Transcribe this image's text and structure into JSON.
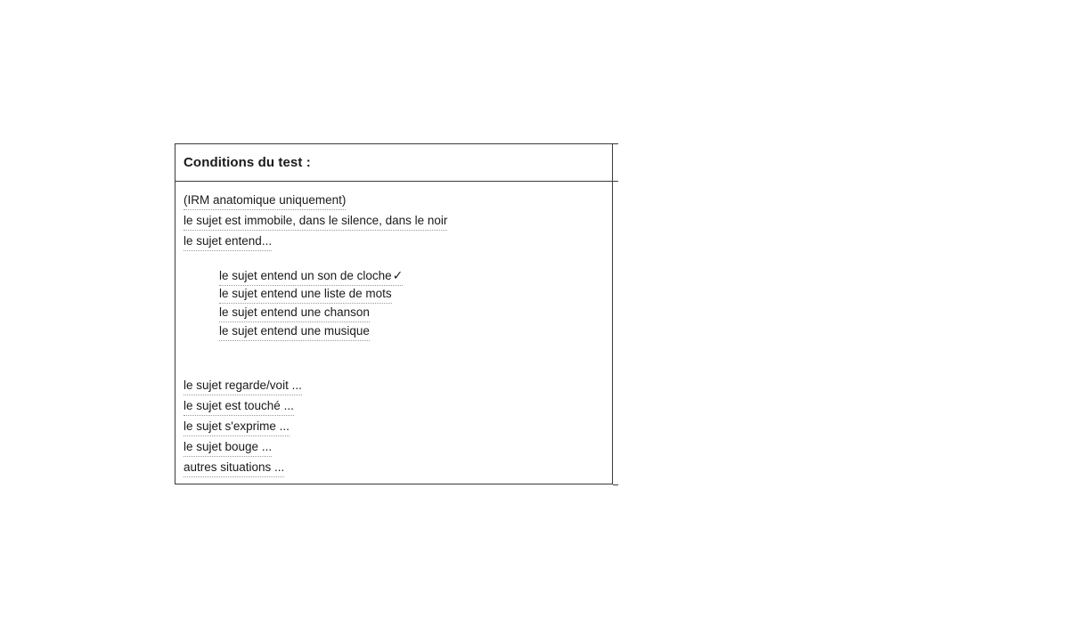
{
  "panel": {
    "title": "Conditions du test :"
  },
  "options": [
    {
      "label": "(IRM anatomique uniquement)"
    },
    {
      "label": "le sujet est immobile, dans le silence, dans le noir"
    },
    {
      "label": "le sujet entend..."
    }
  ],
  "sub_options": [
    {
      "label": "le sujet entend un son de cloche",
      "selected": true,
      "check_symbol": "✓"
    },
    {
      "label": "le sujet entend une liste de mots",
      "selected": false
    },
    {
      "label": "le sujet entend une chanson",
      "selected": false
    },
    {
      "label": "le sujet entend une musique",
      "selected": false
    }
  ],
  "more_options": [
    {
      "label": "le sujet regarde/voit ..."
    },
    {
      "label": "le sujet est touché ..."
    },
    {
      "label": "le sujet s'exprime ..."
    },
    {
      "label": "le sujet bouge ..."
    },
    {
      "label": "autres situations ..."
    }
  ]
}
